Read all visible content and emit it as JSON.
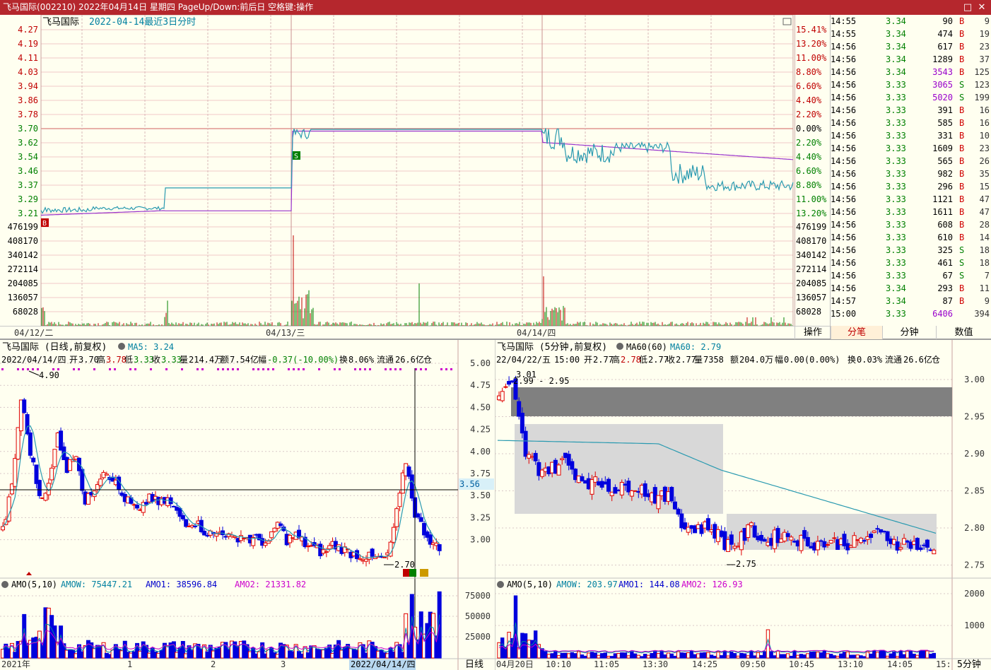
{
  "window": {
    "title": "飞马国际(002210) 2022年04月14日 星期四 PageUp/Down:前后日 空格键:操作",
    "restore_glyph": "□",
    "close_glyph": "✕"
  },
  "intraday": {
    "name": "飞马国际",
    "info": "2022-04-14最近3日分时",
    "price_ticks": [
      "4.27",
      "4.19",
      "4.11",
      "4.03",
      "3.94",
      "3.86",
      "3.78",
      "3.70",
      "3.62",
      "3.54",
      "3.46",
      "3.37",
      "3.29",
      "3.21"
    ],
    "pct_ticks": [
      "15.41%",
      "13.20%",
      "11.00%",
      "8.80%",
      "6.60%",
      "4.40%",
      "2.20%",
      "0.00%",
      "2.20%",
      "4.40%",
      "6.60%",
      "8.80%",
      "11.00%",
      "13.20%"
    ],
    "vol_ticks": [
      "476199",
      "408170",
      "340142",
      "272114",
      "204085",
      "136057",
      "68028"
    ],
    "dates": [
      "04/12/二",
      "04/13/三",
      "04/14/四"
    ],
    "marker_b": "B",
    "marker_s": "S"
  },
  "ticks_table": {
    "rows": [
      {
        "time": "14:55",
        "price": "3.34",
        "vol": "90",
        "side": "B",
        "count": "9"
      },
      {
        "time": "14:55",
        "price": "3.34",
        "vol": "474",
        "side": "B",
        "count": "19"
      },
      {
        "time": "14:56",
        "price": "3.34",
        "vol": "617",
        "side": "B",
        "count": "23"
      },
      {
        "time": "14:56",
        "price": "3.34",
        "vol": "1289",
        "side": "B",
        "count": "37"
      },
      {
        "time": "14:56",
        "price": "3.34",
        "vol": "3543",
        "side": "B",
        "count": "125"
      },
      {
        "time": "14:56",
        "price": "3.33",
        "vol": "3065",
        "side": "S",
        "count": "123"
      },
      {
        "time": "14:56",
        "price": "3.33",
        "vol": "5020",
        "side": "S",
        "count": "199"
      },
      {
        "time": "14:56",
        "price": "3.33",
        "vol": "391",
        "side": "B",
        "count": "16"
      },
      {
        "time": "14:56",
        "price": "3.33",
        "vol": "585",
        "side": "B",
        "count": "16"
      },
      {
        "time": "14:56",
        "price": "3.33",
        "vol": "331",
        "side": "B",
        "count": "10"
      },
      {
        "time": "14:56",
        "price": "3.33",
        "vol": "1609",
        "side": "B",
        "count": "23"
      },
      {
        "time": "14:56",
        "price": "3.33",
        "vol": "565",
        "side": "B",
        "count": "26"
      },
      {
        "time": "14:56",
        "price": "3.33",
        "vol": "982",
        "side": "B",
        "count": "35"
      },
      {
        "time": "14:56",
        "price": "3.33",
        "vol": "296",
        "side": "B",
        "count": "15"
      },
      {
        "time": "14:56",
        "price": "3.33",
        "vol": "1121",
        "side": "B",
        "count": "47"
      },
      {
        "time": "14:56",
        "price": "3.33",
        "vol": "1611",
        "side": "B",
        "count": "47"
      },
      {
        "time": "14:56",
        "price": "3.33",
        "vol": "608",
        "side": "B",
        "count": "28"
      },
      {
        "time": "14:56",
        "price": "3.33",
        "vol": "610",
        "side": "B",
        "count": "14"
      },
      {
        "time": "14:56",
        "price": "3.33",
        "vol": "325",
        "side": "S",
        "count": "18"
      },
      {
        "time": "14:56",
        "price": "3.33",
        "vol": "461",
        "side": "S",
        "count": "18"
      },
      {
        "time": "14:56",
        "price": "3.33",
        "vol": "67",
        "side": "S",
        "count": "7"
      },
      {
        "time": "14:56",
        "price": "3.34",
        "vol": "293",
        "side": "B",
        "count": "11"
      },
      {
        "time": "14:57",
        "price": "3.34",
        "vol": "87",
        "side": "B",
        "count": "9"
      },
      {
        "time": "15:00",
        "price": "3.33",
        "vol": "6406",
        "side": "",
        "count": "394"
      }
    ],
    "colors": {
      "price": "#008000",
      "vol_normal": "#000000",
      "vol_big": "#9900cc",
      "buy": "#d00000",
      "sell": "#008000"
    }
  },
  "tabs": {
    "ops": "操作",
    "ticks": "分笔",
    "minute": "分钟",
    "numbers": "数值"
  },
  "daily": {
    "header": "飞马国际 (日线,前复权)",
    "ma_label": "MA5: 3.24",
    "info_date": "2022/04/14/四",
    "open_label": "开",
    "open": "3.70",
    "high_label": "高",
    "high": "3.78",
    "low_label": "低",
    "low": "3.33",
    "close_label": "收",
    "close": "3.33",
    "vol_label": "量",
    "vol": "214.4万",
    "amt_label": "额",
    "amt": "7.54亿",
    "chg_label": "幅",
    "chg": "-0.37(-10.00%)",
    "turn_label": "换",
    "turn": "8.06%",
    "float_label": "流通",
    "float": "26.6亿",
    "warehouse": "仓",
    "y_ticks": [
      "5.00",
      "4.75",
      "4.50",
      "4.25",
      "4.00",
      "3.75",
      "3.50",
      "3.25",
      "3.00"
    ],
    "cursor_price": "3.56",
    "high_mark": "4.90",
    "low_mark": "2.70",
    "amo_title": "AMO(5,10)",
    "amow": "AMOW: 75447.21",
    "amo1": "AMO1: 38596.84",
    "amo2": "AMO2: 21331.82",
    "amo_ticks": [
      "75000",
      "50000",
      "25000"
    ],
    "x_labels": [
      "2021年",
      "1",
      "2",
      "3",
      "2022/04/14/四"
    ],
    "period": "日线"
  },
  "minute5": {
    "header": "飞马国际 (5分钟,前复权)",
    "ma_label": "MA60(60)",
    "ma_value": "MA60: 2.79",
    "info_date": "22/04/22/五",
    "time": "15:00",
    "open_label": "开",
    "open": "2.77",
    "high_label": "高",
    "high": "2.78",
    "low_label": "低",
    "low": "2.77",
    "close_label": "收",
    "close": "2.77",
    "vol_label": "量",
    "vol": "7358",
    "amt_label": "额",
    "amt": "204.0万",
    "chg_label": "幅",
    "chg": "0.00(0.00%)",
    "turn_label": "换",
    "turn": "0.03%",
    "float_label": "流通",
    "float": "26.6亿",
    "warehouse": "仓",
    "y_ticks": [
      "3.00",
      "2.95",
      "2.90",
      "2.85",
      "2.80",
      "2.75"
    ],
    "high_mark": "3.01",
    "range_mark": "2.99 - 2.95",
    "low_mark": "2.75",
    "amo_title": "AMO(5,10)",
    "amow": "AMOW: 203.97",
    "amo1": "AMO1: 144.08",
    "amo2": "AMO2: 126.93",
    "amo_ticks": [
      "2000",
      "1000"
    ],
    "x_labels": [
      "04月20日",
      "10:10",
      "11:05",
      "13:30",
      "14:25",
      "09:50",
      "10:45",
      "13:10",
      "14:05",
      "15:"
    ],
    "period": "5分钟"
  }
}
